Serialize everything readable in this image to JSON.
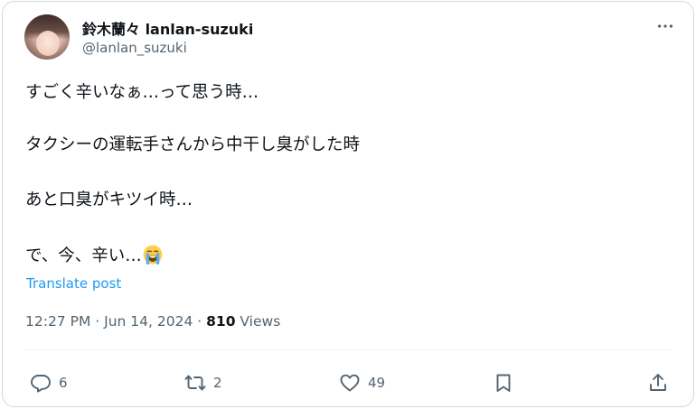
{
  "author": {
    "display_name": "鈴木蘭々 lanlan-suzuki",
    "handle": "@lanlan_suzuki",
    "avatar_icon": "profile-photo"
  },
  "tweet": {
    "lines": [
      "すごく辛いなぁ…って思う時…",
      "タクシーの運転手さんから中干し臭がした時",
      "あと口臭がキツイ時…",
      "で、今、辛い…"
    ],
    "emoji": "loudly-crying-face-emoji",
    "translate_label": "Translate post"
  },
  "meta": {
    "time": "12:27 PM",
    "date": "Jun 14, 2024",
    "separator": "·",
    "views_count": "810",
    "views_label": "Views"
  },
  "actions": {
    "replies": "6",
    "reposts": "2",
    "likes": "49"
  },
  "colors": {
    "text": "#0f1419",
    "secondary": "#536471",
    "link": "#1d9bf0",
    "border": "#cfd9de"
  }
}
